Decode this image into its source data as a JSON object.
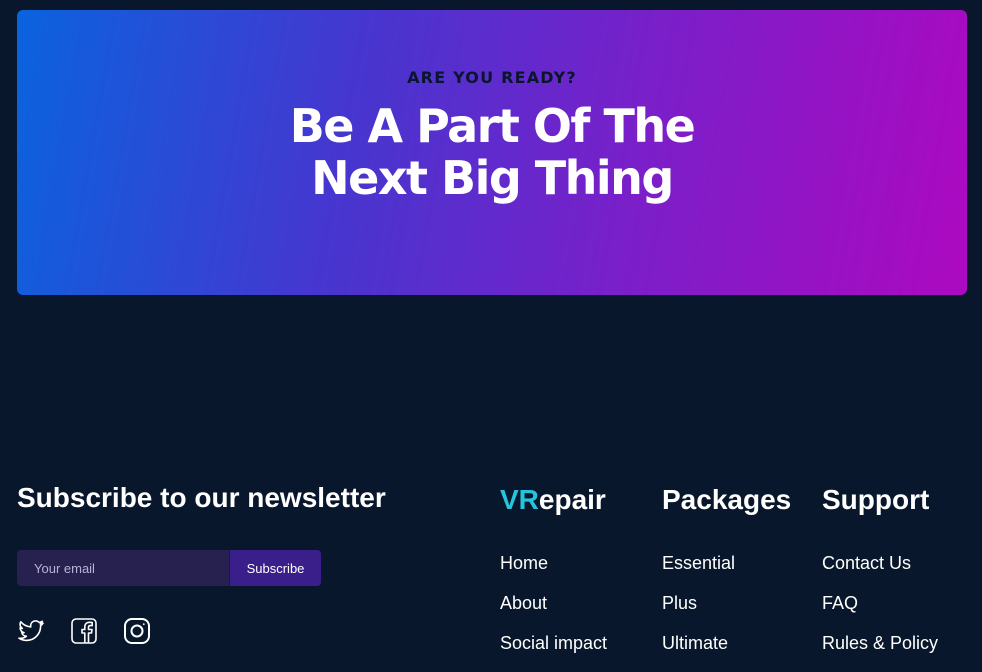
{
  "cta": {
    "eyebrow": "ARE YOU READY?",
    "heading_line1": "Be A Part Of The",
    "heading_line2": "Next Big Thing"
  },
  "newsletter": {
    "title": "Subscribe to our newsletter",
    "email_placeholder": "Your email",
    "email_value": "",
    "button_label": "Subscribe"
  },
  "social": [
    {
      "icon": "twitter-icon"
    },
    {
      "icon": "facebook-icon"
    },
    {
      "icon": "instagram-icon"
    }
  ],
  "footer": {
    "brand": {
      "title_accent": "VR",
      "title_rest": "epair",
      "links": [
        "Home",
        "About",
        "Social impact"
      ]
    },
    "packages": {
      "title": "Packages",
      "links": [
        "Essential",
        "Plus",
        "Ultimate"
      ]
    },
    "support": {
      "title": "Support",
      "links": [
        "Contact Us",
        "FAQ",
        "Rules & Policy"
      ]
    }
  },
  "colors": {
    "background": "#08172b",
    "gradient_start": "#0a63de",
    "gradient_end": "#ad09c0",
    "brand_accent": "#25c3dc",
    "input_bg": "#26214e",
    "button_bg": "#3a1f8a"
  }
}
